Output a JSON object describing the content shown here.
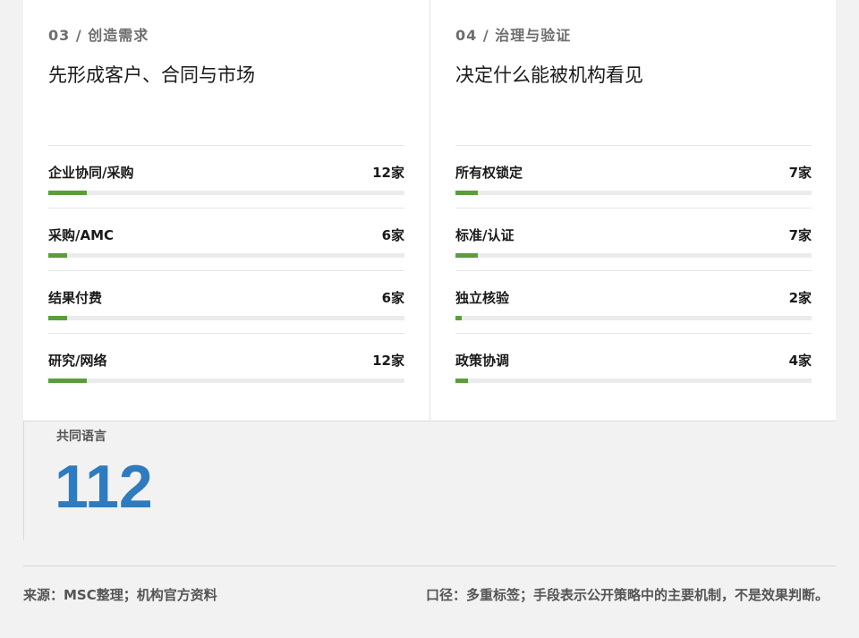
{
  "cards": [
    {
      "kicker": "03 / 创造需求",
      "title": "先形成客户、合同与市场",
      "rows": [
        {
          "label": "企业协同/采购",
          "count": "12家",
          "value": 12
        },
        {
          "label": "采购/AMC",
          "count": "6家",
          "value": 6
        },
        {
          "label": "结果付费",
          "count": "6家",
          "value": 6
        },
        {
          "label": "研究/网络",
          "count": "12家",
          "value": 12
        }
      ]
    },
    {
      "kicker": "04 / 治理与验证",
      "title": "决定什么能被机构看见",
      "rows": [
        {
          "label": "所有权锁定",
          "count": "7家",
          "value": 7
        },
        {
          "label": "标准/认证",
          "count": "7家",
          "value": 7
        },
        {
          "label": "独立核验",
          "count": "2家",
          "value": 2
        },
        {
          "label": "政策协调",
          "count": "4家",
          "value": 4
        }
      ]
    }
  ],
  "bar_scale_max": 112,
  "bar_color": "#5a9e3a",
  "common_language": {
    "label": "共同语言",
    "value": "112"
  },
  "footer": {
    "source": "来源：MSC整理；机构官方资料",
    "note": "口径：多重标签；手段表示公开策略中的主要机制，不是效果判断。"
  }
}
